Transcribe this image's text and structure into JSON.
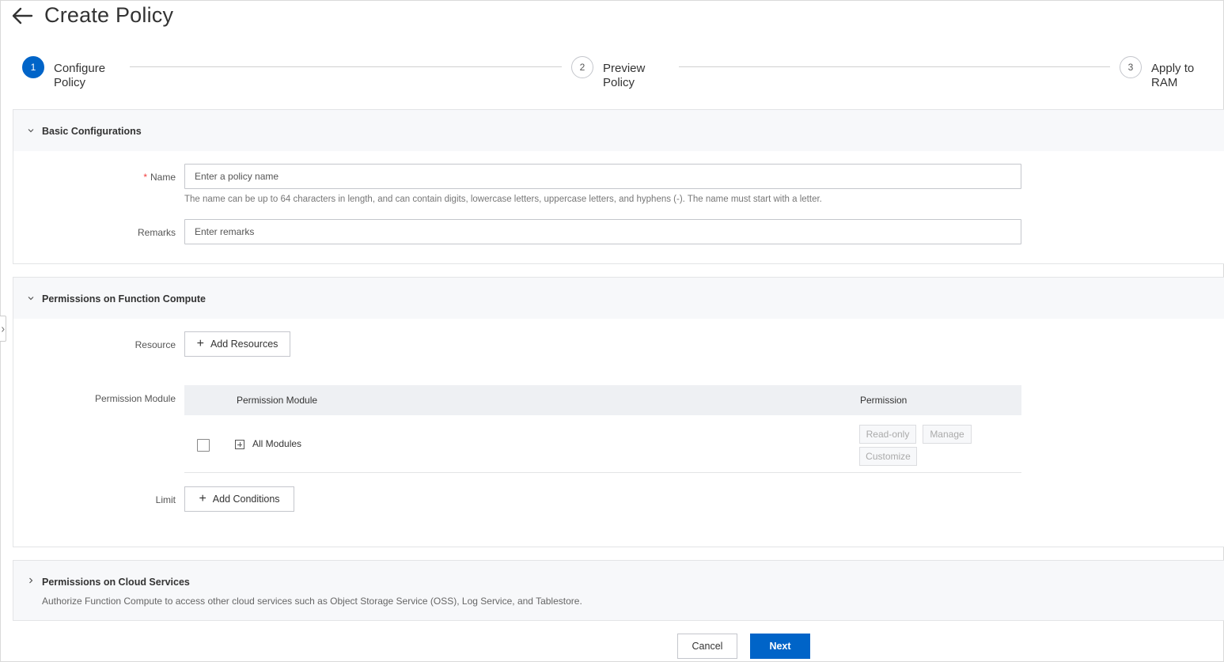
{
  "header": {
    "title": "Create Policy"
  },
  "steps": [
    {
      "number": "1",
      "label_line1": "Configure",
      "label_line2": "Policy",
      "state": "active"
    },
    {
      "number": "2",
      "label_line1": "Preview",
      "label_line2": "Policy",
      "state": "pending"
    },
    {
      "number": "3",
      "label_line1": "Apply to",
      "label_line2": "RAM",
      "state": "pending"
    }
  ],
  "basic": {
    "title": "Basic Configurations",
    "name_label": "Name",
    "name_required_mark": "*",
    "name_placeholder": "Enter a policy name",
    "name_value": "",
    "name_help": "The name can be up to 64 characters in length, and can contain digits, lowercase letters, uppercase letters, and hyphens (-). The name must start with a letter.",
    "remarks_label": "Remarks",
    "remarks_placeholder": "Enter remarks",
    "remarks_value": ""
  },
  "fc": {
    "title": "Permissions on Function Compute",
    "resource_label": "Resource",
    "add_resources_label": "Add Resources",
    "module_label": "Permission Module",
    "table": {
      "columns": [
        "Permission Module",
        "Permission"
      ],
      "rows": [
        {
          "module": "All Modules",
          "checked": false,
          "actions": [
            "Read-only",
            "Manage",
            "Customize"
          ]
        }
      ]
    },
    "limit_label": "Limit",
    "add_conditions_label": "Add Conditions"
  },
  "cloud": {
    "title": "Permissions on Cloud Services",
    "description": "Authorize Function Compute to access other cloud services such as Object Storage Service (OSS), Log Service, and Tablestore."
  },
  "footer": {
    "cancel_label": "Cancel",
    "next_label": "Next"
  },
  "colors": {
    "primary": "#0064c8",
    "required": "#f23c3c",
    "section_bg": "#f7f8fa"
  },
  "icons": {
    "back": "back-arrow-icon",
    "collapse": "chevron-down-icon",
    "expand_section": "chevron-right-icon",
    "add": "plus-icon",
    "tree_expand": "plus-square-icon"
  }
}
